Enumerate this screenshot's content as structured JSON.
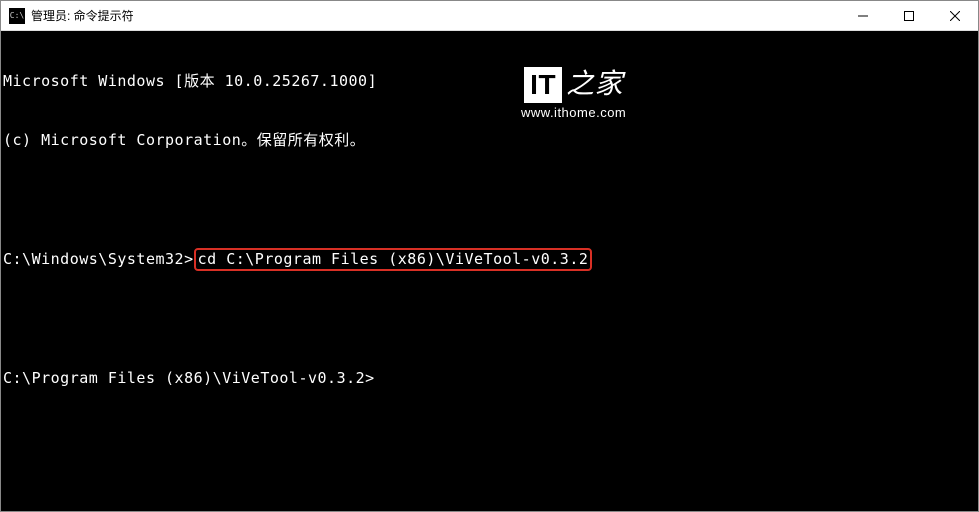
{
  "window": {
    "icon_text": "C:\\",
    "title": "管理员: 命令提示符"
  },
  "terminal": {
    "line1": "Microsoft Windows [版本 10.0.25267.1000]",
    "line2": "(c) Microsoft Corporation。保留所有权利。",
    "prompt1_prefix": "C:\\Windows\\System32>",
    "prompt1_command": "cd C:\\Program Files (x86)\\ViVeTool-v0.3.2",
    "prompt2": "C:\\Program Files (x86)\\ViVeTool-v0.3.2>"
  },
  "watermark": {
    "logo_it": "IT",
    "logo_text": "之家",
    "url": "www.ithome.com"
  }
}
